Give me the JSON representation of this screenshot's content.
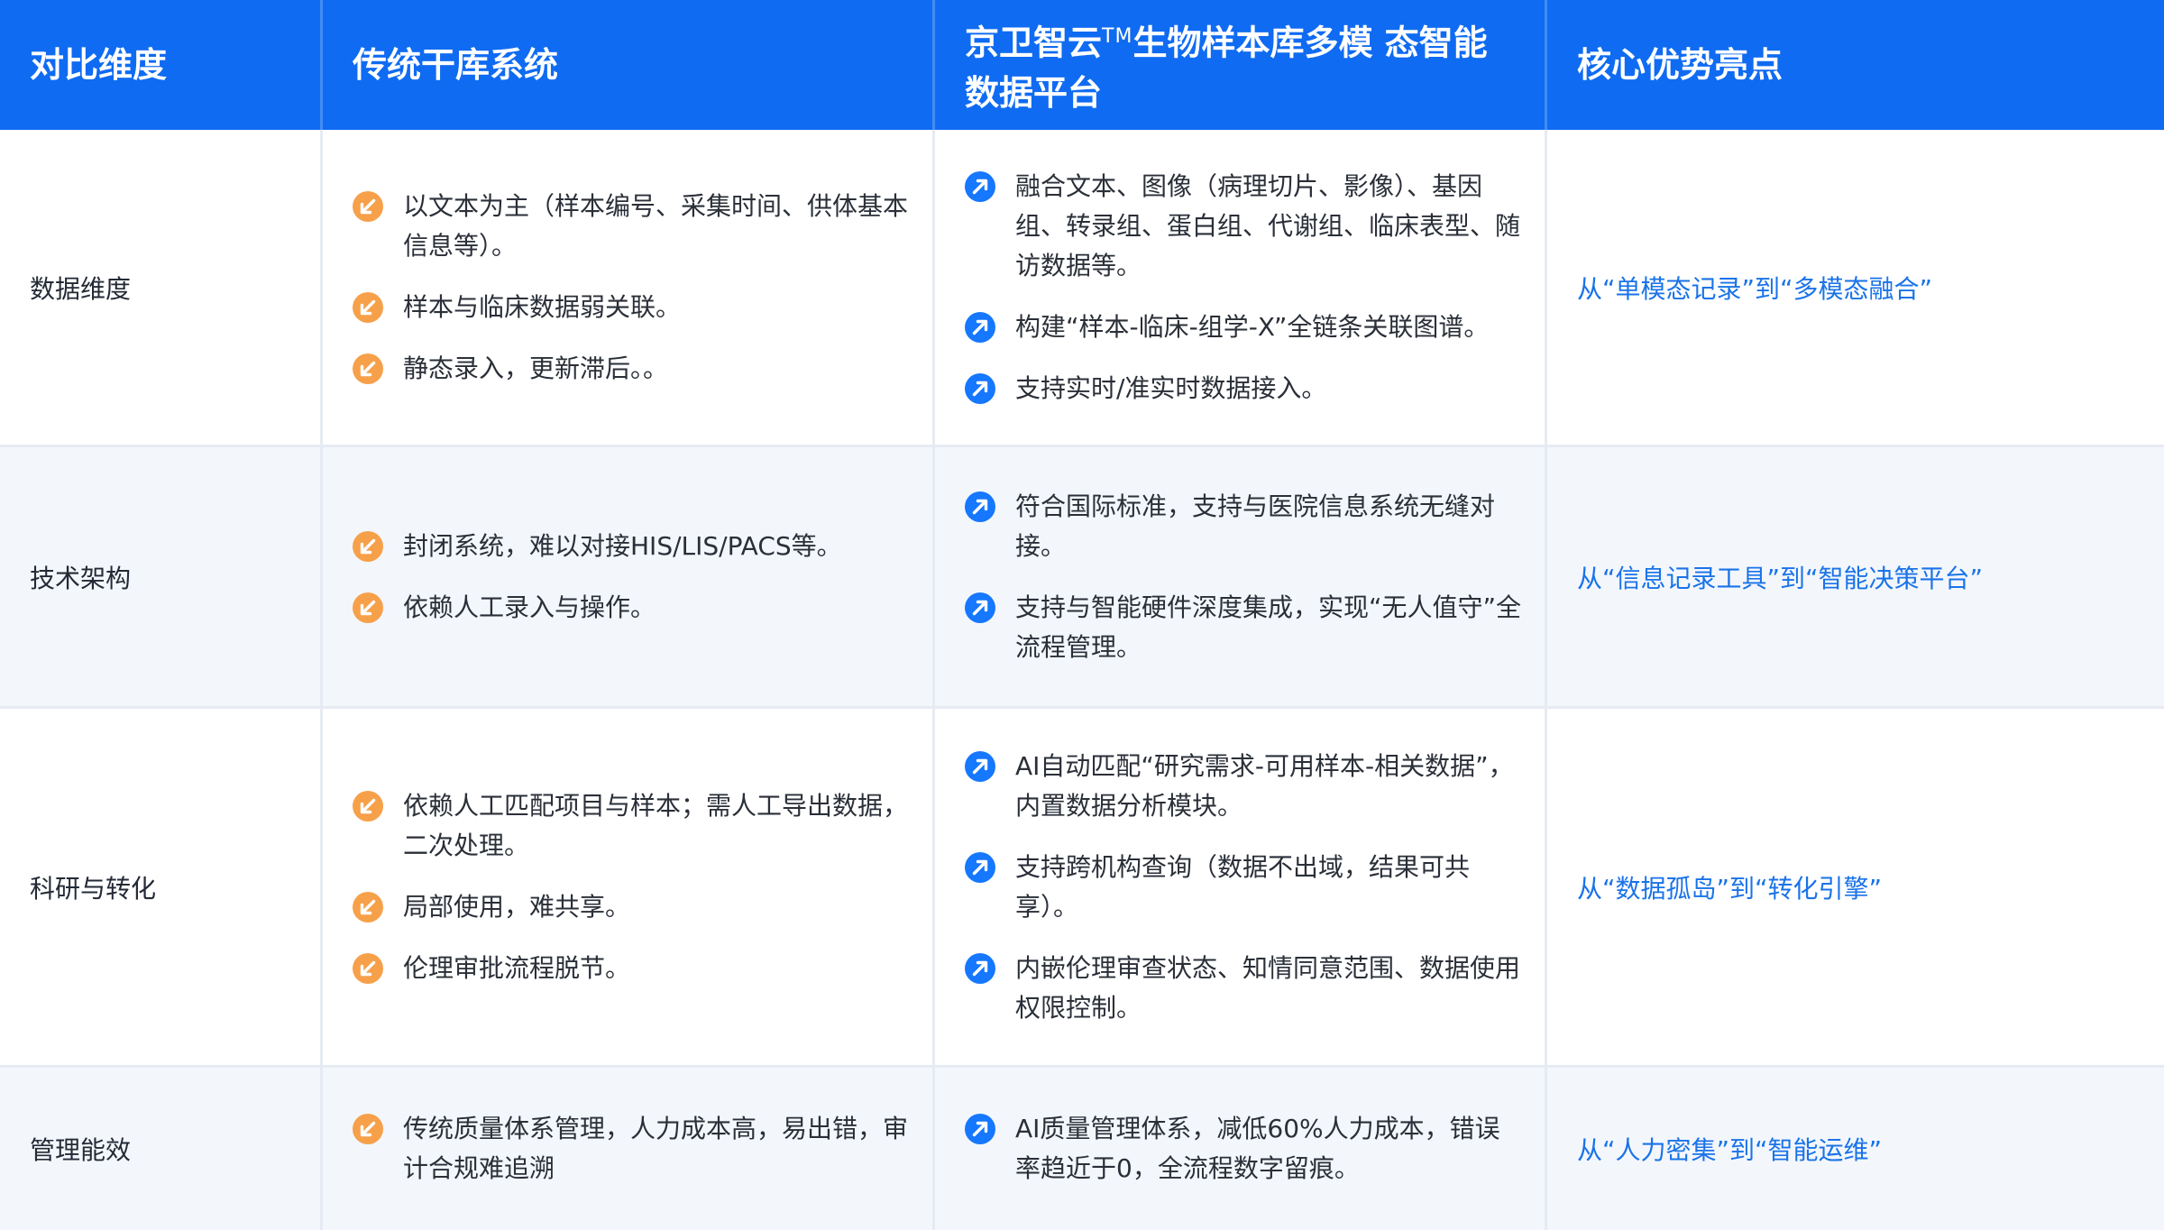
{
  "header": {
    "col1": "对比维度",
    "col2": "传统干库系统",
    "col3_pre": "京卫智云",
    "col3_tm": "TM",
    "col3_post": "生物样本库多模 态智能数据平台",
    "col4": "核心优势亮点"
  },
  "rows": [
    {
      "dimension": "数据维度",
      "traditional": [
        "以文本为主（样本编号、采集时间、供体基本信息等）。",
        "样本与临床数据弱关联。",
        "静态录入，更新滞后。。"
      ],
      "platform": [
        "融合文本、图像（病理切片、影像）、基因组、转录组、蛋白组、代谢组、临床表型、随访数据等。",
        "构建“样本-临床-组学-X”全链条关联图谱。",
        "支持实时/准实时数据接入。"
      ],
      "advantage": "从“单模态记录”到“多模态融合”"
    },
    {
      "dimension": "技术架构",
      "traditional": [
        "封闭系统，难以对接HIS/LIS/PACS等。",
        "依赖人工录入与操作。"
      ],
      "platform": [
        "符合国际标准，支持与医院信息系统无缝对接。",
        "支持与智能硬件深度集成，实现“无人值守”全流程管理。"
      ],
      "advantage": "从“信息记录工具”到“智能决策平台”"
    },
    {
      "dimension": "科研与转化",
      "traditional": [
        "依赖人工匹配项目与样本；需人工导出数据，二次处理。",
        "局部使用，难共享。",
        "伦理审批流程脱节。"
      ],
      "platform": [
        "AI自动匹配“研究需求-可用样本-相关数据”，内置数据分析模块。",
        "支持跨机构查询（数据不出域，结果可共享）。",
        "内嵌伦理审查状态、知情同意范围、数据使用权限控制。"
      ],
      "advantage": "从“数据孤岛”到“转化引擎”"
    },
    {
      "dimension": "管理能效",
      "traditional": [
        "传统质量体系管理，人力成本高，易出错，审计合规难追溯"
      ],
      "platform": [
        "AI质量管理体系，减低60%人力成本，错误率趋近于0，全流程数字留痕。"
      ],
      "advantage": "从“人力密集”到“智能运维”"
    }
  ],
  "colors": {
    "header_bg": "#0f6bf2",
    "advantage_text": "#1a73e8",
    "traditional_icon": "#f7a04a",
    "platform_icon": "#1677ff",
    "alt_row_bg": "#f3f7fc"
  },
  "icons": {
    "traditional": "arrow-down-left-circle-icon",
    "platform": "arrow-up-right-circle-icon"
  }
}
